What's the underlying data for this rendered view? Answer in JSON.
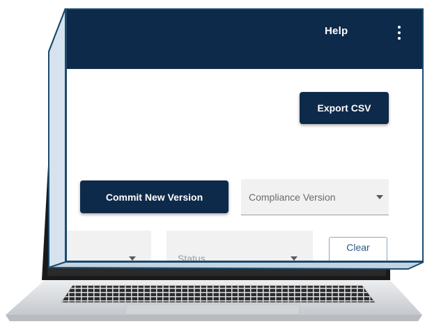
{
  "header": {
    "help_label": "Help",
    "menu_icon": "kebab-menu-icon"
  },
  "toolbar": {
    "export_label": "Export CSV",
    "commit_label": "Commit New Version"
  },
  "compliance_select": {
    "value": "Compliance Version"
  },
  "filters": {
    "filter2_value": "Status",
    "clear_label": "Clear"
  },
  "colors": {
    "header_bg": "#0e2a4a",
    "frame_border": "#1b4a6e",
    "select_bg": "#f1f1f1",
    "laptop_silver": "#d9dadc"
  }
}
